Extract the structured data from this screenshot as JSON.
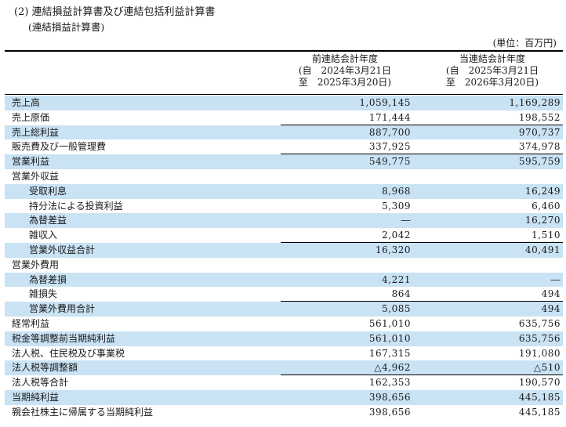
{
  "header": {
    "title": "(2) 連結損益計算書及び連結包括利益計算書",
    "subtitle": "(連結損益計算書)",
    "unit": "(単位：百万円)"
  },
  "columns": [
    {
      "line1": "前連結会計年度",
      "line2": "(自　2024年3月21日",
      "line3": "至　2025年3月20日)"
    },
    {
      "line1": "当連結会計年度",
      "line2": "(自　2025年3月21日",
      "line3": "至　2026年3月20日)"
    }
  ],
  "rows": [
    {
      "label": "売上高",
      "prev": "1,059,145",
      "curr": "1,169,289",
      "indent": 0,
      "shade": true
    },
    {
      "label": "売上原価",
      "prev": "171,444",
      "curr": "198,552",
      "indent": 0,
      "shade": false,
      "sep": true
    },
    {
      "label": "売上総利益",
      "prev": "887,700",
      "curr": "970,737",
      "indent": 0,
      "shade": true
    },
    {
      "label": "販売費及び一般管理費",
      "prev": "337,925",
      "curr": "374,978",
      "indent": 0,
      "shade": false,
      "sep": true
    },
    {
      "label": "営業利益",
      "prev": "549,775",
      "curr": "595,759",
      "indent": 0,
      "shade": true
    },
    {
      "label": "営業外収益",
      "prev": "",
      "curr": "",
      "indent": 0,
      "shade": false
    },
    {
      "label": "受取利息",
      "prev": "8,968",
      "curr": "16,249",
      "indent": 1,
      "shade": true
    },
    {
      "label": "持分法による投資利益",
      "prev": "5,309",
      "curr": "6,460",
      "indent": 1,
      "shade": false
    },
    {
      "label": "為替差益",
      "prev": "―",
      "curr": "16,270",
      "indent": 1,
      "shade": true
    },
    {
      "label": "雑収入",
      "prev": "2,042",
      "curr": "1,510",
      "indent": 1,
      "shade": false,
      "sep": true
    },
    {
      "label": "営業外収益合計",
      "prev": "16,320",
      "curr": "40,491",
      "indent": 2,
      "shade": true
    },
    {
      "label": "営業外費用",
      "prev": "",
      "curr": "",
      "indent": 0,
      "shade": false
    },
    {
      "label": "為替差損",
      "prev": "4,221",
      "curr": "―",
      "indent": 1,
      "shade": true
    },
    {
      "label": "雑損失",
      "prev": "864",
      "curr": "494",
      "indent": 1,
      "shade": false,
      "sep": true
    },
    {
      "label": "営業外費用合計",
      "prev": "5,085",
      "curr": "494",
      "indent": 2,
      "shade": true
    },
    {
      "label": "経常利益",
      "prev": "561,010",
      "curr": "635,756",
      "indent": 0,
      "shade": false
    },
    {
      "label": "税金等調整前当期純利益",
      "prev": "561,010",
      "curr": "635,756",
      "indent": 0,
      "shade": true
    },
    {
      "label": "法人税、住民税及び事業税",
      "prev": "167,315",
      "curr": "191,080",
      "indent": 0,
      "shade": false
    },
    {
      "label": "法人税等調整額",
      "prev": "△4,962",
      "curr": "△510",
      "indent": 0,
      "shade": true,
      "sep": true
    },
    {
      "label": "法人税等合計",
      "prev": "162,353",
      "curr": "190,570",
      "indent": 0,
      "shade": false
    },
    {
      "label": "当期純利益",
      "prev": "398,656",
      "curr": "445,185",
      "indent": 0,
      "shade": true
    },
    {
      "label": "親会社株主に帰属する当期純利益",
      "prev": "398,656",
      "curr": "445,185",
      "indent": 0,
      "shade": false
    }
  ]
}
